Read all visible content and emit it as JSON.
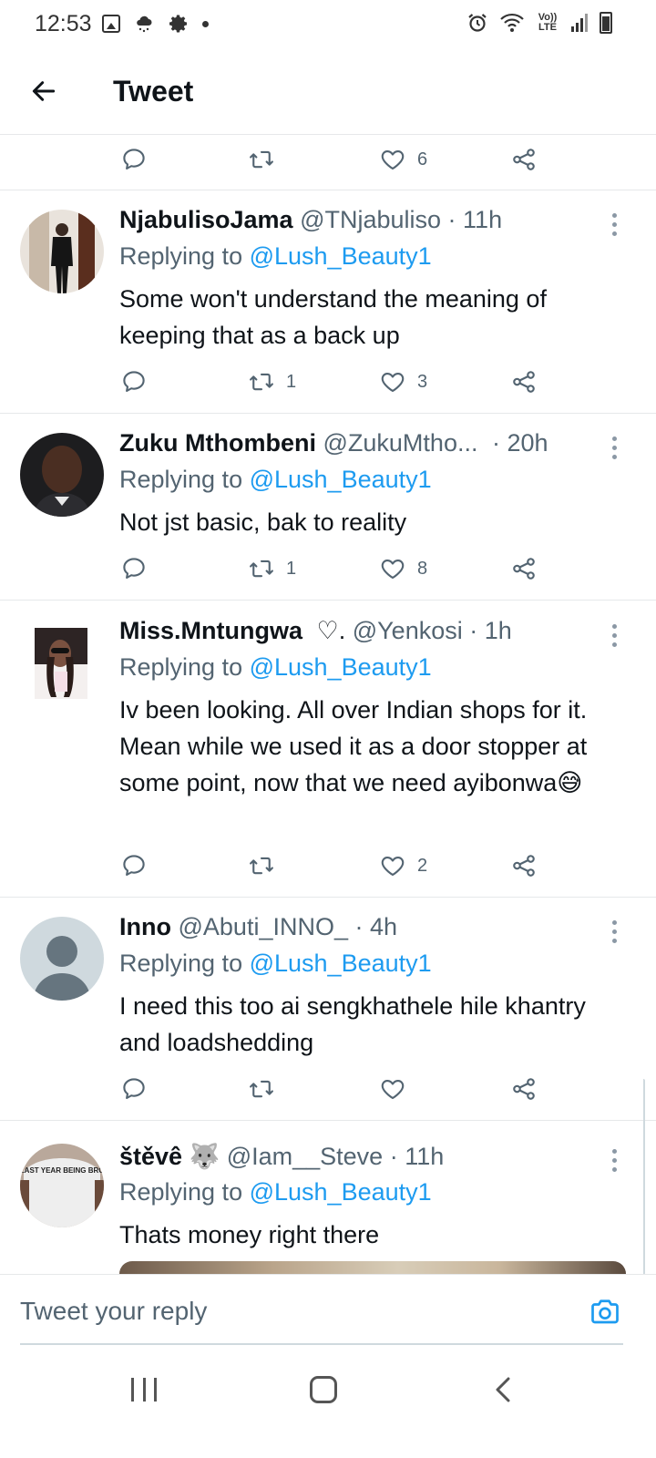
{
  "status_bar": {
    "time": "12:53",
    "network": "Vo)) LTE"
  },
  "header": {
    "title": "Tweet"
  },
  "top_actions": {
    "reply_count": "",
    "retweet_count": "",
    "like_count": "6"
  },
  "tweets": [
    {
      "name": "NjabulisoJama",
      "handle": "@TNjabuliso · 11h",
      "replying_prefix": "Replying to ",
      "replying_to": "@Lush_Beauty1",
      "text": "Some won't understand the meaning of keeping that as a back up",
      "retweet_count": "1",
      "like_count": "3"
    },
    {
      "name": "Zuku Mthombeni",
      "handle": "@ZukuMtho...",
      "time": " · 20h",
      "replying_prefix": "Replying to ",
      "replying_to": "@Lush_Beauty1",
      "text": "Not jst basic, bak to reality",
      "retweet_count": "1",
      "like_count": "8"
    },
    {
      "name": "Miss.Mntungwa",
      "name_suffix": " ♡.",
      "handle": "@Yenkosi · 1h",
      "replying_prefix": "Replying to ",
      "replying_to": "@Lush_Beauty1",
      "text": "Iv been looking. All over Indian shops for it. Mean while we used it as a door stopper at some point, now that we need ayibonwa😅",
      "retweet_count": "",
      "like_count": "2"
    },
    {
      "name": "Inno",
      "handle": "@Abuti_INNO_ · 4h",
      "replying_prefix": "Replying to ",
      "replying_to": "@Lush_Beauty1",
      "text": "I need this too ai sengkhathele hile khantry and loadshedding",
      "retweet_count": "",
      "like_count": ""
    },
    {
      "name": "štěvê 🐺",
      "handle": "@Iam__Steve · 11h",
      "replying_prefix": "Replying to ",
      "replying_to": "@Lush_Beauty1",
      "text": "Thats money right  there",
      "avatar_shirt_text": "MY LAST YEAR BEING BROKE!"
    }
  ],
  "reply_bar": {
    "placeholder": "Tweet your reply"
  },
  "colors": {
    "accent": "#1d9bf0",
    "text": "#0f1419",
    "muted": "#536471",
    "divider": "#e6e8ea"
  }
}
